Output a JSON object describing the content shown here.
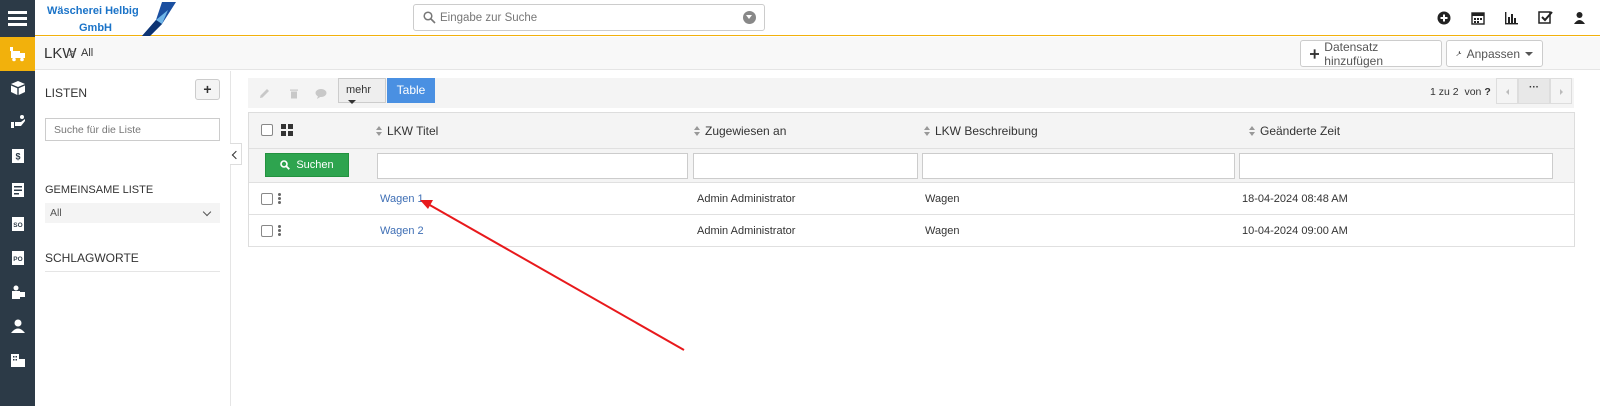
{
  "brand": {
    "line1": "Wäscherei Helbig",
    "line2": "GmbH",
    "color": "#1a73c8"
  },
  "search": {
    "placeholder": "Eingabe zur Suche"
  },
  "top_icons": [
    "plus-circle-icon",
    "calendar-icon",
    "bar-chart-icon",
    "checkbox-icon",
    "user-icon"
  ],
  "rail_icons": [
    "truck-icon",
    "box-icon",
    "hand-icon",
    "invoice-icon",
    "document-icon",
    "so-icon",
    "po-icon",
    "person-box-icon",
    "person-icon",
    "building-icon"
  ],
  "breadcrumb": {
    "module": "LKW",
    "separator": ">",
    "current": "All"
  },
  "actions": {
    "add_record": "Datensatz hinzufügen",
    "customize": "Anpassen"
  },
  "lists_panel": {
    "title": "LISTEN",
    "add_label": "+",
    "search_placeholder": "Suche für die Liste",
    "shared_title": "GEMEINSAME LISTE",
    "shared_selected": "All",
    "tags_title": "SCHLAGWORTE"
  },
  "toolbar": {
    "more_label": "mehr",
    "table_label": "Table"
  },
  "pagination": {
    "range": "1 zu 2",
    "of_label": "von",
    "total": "?",
    "more": "···"
  },
  "table": {
    "search_button": "Suchen",
    "columns": [
      "LKW Titel",
      "Zugewiesen an",
      "LKW Beschreibung",
      "Geänderte Zeit"
    ],
    "rows": [
      {
        "title": "Wagen 1",
        "assigned": "Admin Administrator",
        "description": "Wagen",
        "modified": "18-04-2024 08:48 AM"
      },
      {
        "title": "Wagen 2",
        "assigned": "Admin Administrator",
        "description": "Wagen",
        "modified": "10-04-2024 09:00 AM"
      }
    ]
  },
  "colors": {
    "accent": "#f2b10c",
    "rail": "#2c3a47",
    "primary_button": "#4a90e2",
    "search_button": "#2ea44f",
    "link": "#3f6fb5",
    "annotation_arrow": "#e8191c"
  }
}
